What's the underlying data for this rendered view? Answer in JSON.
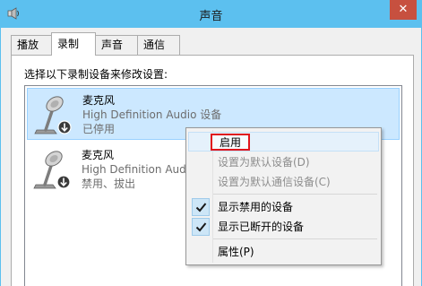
{
  "window": {
    "title": "声音",
    "close_label": "✕",
    "icons": {
      "app": "speaker-icon",
      "close": "close-icon"
    }
  },
  "tabs": [
    {
      "label": "播放",
      "active": false
    },
    {
      "label": "录制",
      "active": true
    },
    {
      "label": "声音",
      "active": false
    },
    {
      "label": "通信",
      "active": false
    }
  ],
  "panel": {
    "instruction": "选择以下录制设备来修改设置:"
  },
  "devices": [
    {
      "name": "麦克风",
      "driver": "High Definition Audio 设备",
      "status": "已停用",
      "selected": true,
      "icon": "microphone-icon",
      "overlay_icon": "disabled-arrow-badge-icon"
    },
    {
      "name": "麦克风",
      "driver": "High Definition Audio 设备",
      "status": "禁用、拔出",
      "selected": false,
      "icon": "microphone-icon",
      "overlay_icon": "disabled-arrow-badge-icon"
    }
  ],
  "context_menu": {
    "items": [
      {
        "label": "启用",
        "enabled": true,
        "checked": false,
        "highlighted": true
      },
      {
        "label": "设置为默认设备(D)",
        "enabled": false,
        "checked": false
      },
      {
        "label": "设置为默认通信设备(C)",
        "enabled": false,
        "checked": false
      },
      {
        "label": "显示禁用的设备",
        "enabled": true,
        "checked": true
      },
      {
        "label": "显示已断开的设备",
        "enabled": true,
        "checked": true
      },
      {
        "label": "属性(P)",
        "enabled": true,
        "checked": false
      }
    ],
    "check_icon": "checkmark-icon",
    "highlight_color": "#e0161d"
  },
  "colors": {
    "titlebar": "#5cc0ef",
    "close_button": "#c7503f",
    "selection": "#cce8ff"
  }
}
